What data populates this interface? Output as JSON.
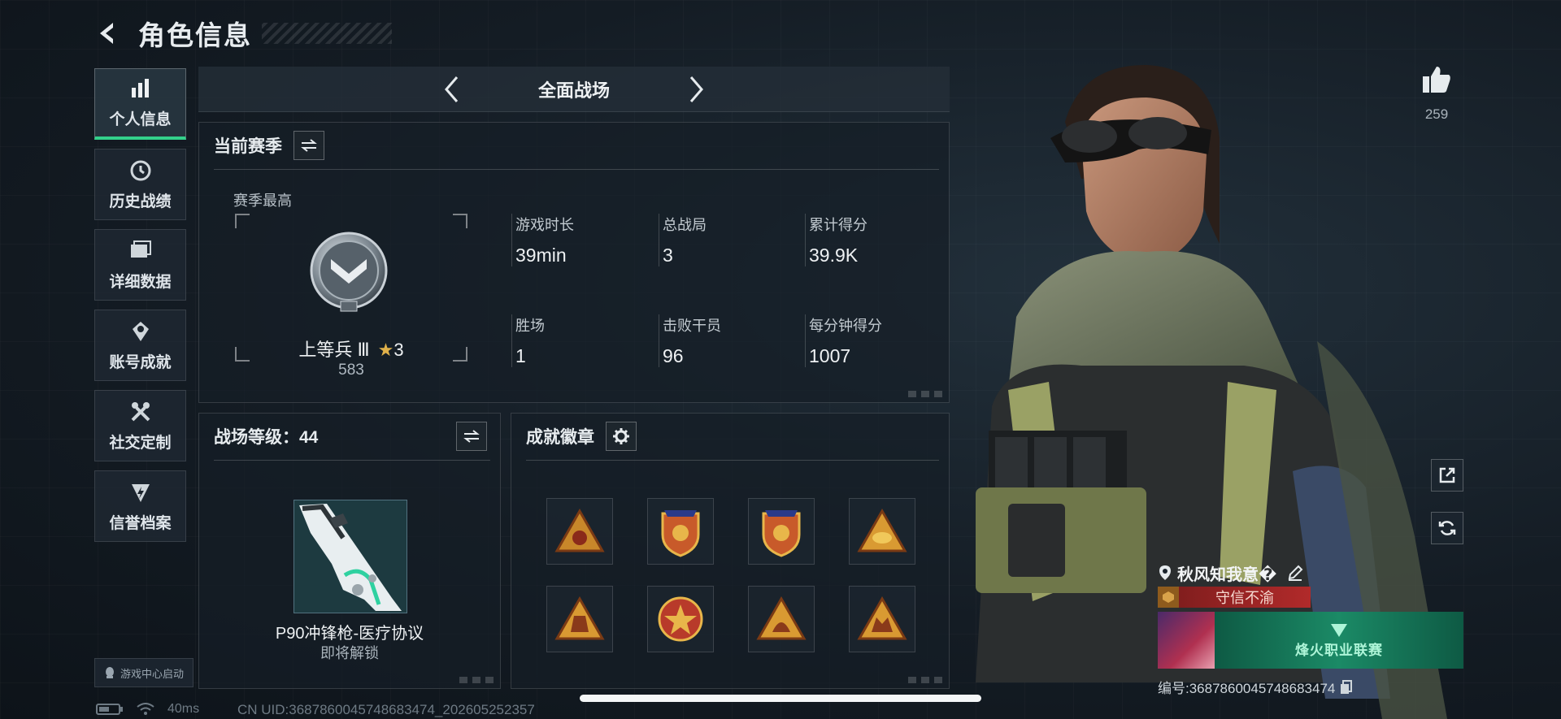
{
  "header": {
    "title": "角色信息"
  },
  "sidebar": {
    "items": [
      {
        "label": "个人信息",
        "icon": "bar-chart-icon",
        "active": true
      },
      {
        "label": "历史战绩",
        "icon": "history-icon"
      },
      {
        "label": "详细数据",
        "icon": "folder-icon"
      },
      {
        "label": "账号成就",
        "icon": "achievement-icon"
      },
      {
        "label": "社交定制",
        "icon": "tools-icon"
      },
      {
        "label": "信誉档案",
        "icon": "credit-icon"
      }
    ],
    "game_center": "游戏中心启动"
  },
  "mode": {
    "title": "全面战场"
  },
  "season": {
    "title": "当前赛季",
    "best_label": "赛季最高",
    "rank_name": "上等兵 Ⅲ",
    "rank_stars": "3",
    "rank_points": "583",
    "stats": [
      {
        "label": "游戏时长",
        "value": "39min"
      },
      {
        "label": "总战局",
        "value": "3"
      },
      {
        "label": "累计得分",
        "value": "39.9K"
      },
      {
        "label": "胜场",
        "value": "1"
      },
      {
        "label": "击败干员",
        "value": "96"
      },
      {
        "label": "每分钟得分",
        "value": "1007"
      }
    ]
  },
  "battlefield": {
    "title": "战场等级：44",
    "weapon_name": "P90冲锋枪-医疗协议",
    "weapon_status": "即将解锁"
  },
  "badges": {
    "title": "成就徽章",
    "items": [
      {
        "icon": "triangle-badge-icon"
      },
      {
        "icon": "shield-badge-icon"
      },
      {
        "icon": "shield-badge-icon"
      },
      {
        "icon": "triangle-badge-icon"
      },
      {
        "icon": "triangle-badge-icon"
      },
      {
        "icon": "star-medal-badge-icon"
      },
      {
        "icon": "triangle-badge-icon"
      },
      {
        "icon": "triangle-badge-icon"
      }
    ]
  },
  "profile": {
    "likes": "259",
    "player_name": "秋风知我意�",
    "player_title": "守信不渝",
    "banner_text": "烽火职业联赛",
    "player_id": "编号:3687860045748683474"
  },
  "statusbar": {
    "ping": "40ms",
    "uid": "CN UID:3687860045748683474_202605252357"
  },
  "colors": {
    "accent": "#33d18b",
    "gold": "#e0b14a",
    "title_red": "#b12a2a"
  }
}
